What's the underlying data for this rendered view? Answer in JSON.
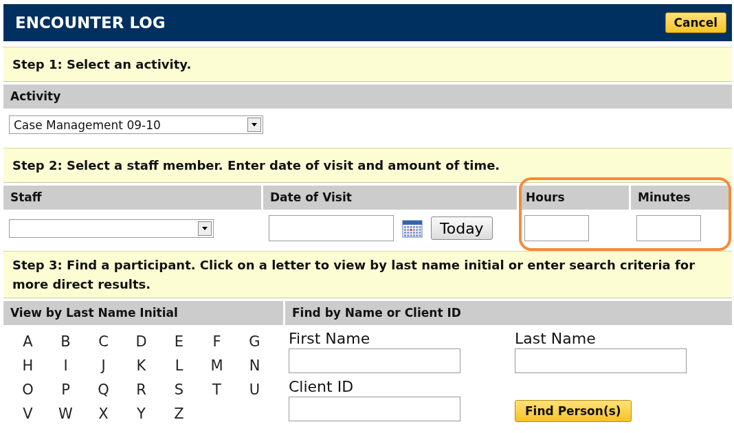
{
  "header": {
    "title": "ENCOUNTER LOG",
    "cancel_button": "Cancel"
  },
  "step1": {
    "instruction": "Step 1: Select an activity.",
    "column": "Activity",
    "activity_select": {
      "value": "Case Management 09-10"
    }
  },
  "step2": {
    "instruction": "Step 2: Select a staff member. Enter date of visit and amount of time.",
    "columns": [
      "Staff",
      "Date of Visit",
      "Hours",
      "Minutes"
    ],
    "today_button": "Today",
    "time_fields_circled": true
  },
  "step3": {
    "instruction": "Step 3: Find a participant. Click on a letter to view by last name initial or enter search criteria for more direct results.",
    "columns": [
      "View by Last Name Initial",
      "Find by Name or Client ID"
    ],
    "letters": [
      "A",
      "B",
      "C",
      "D",
      "E",
      "F",
      "G",
      "H",
      "I",
      "J",
      "K",
      "L",
      "M",
      "N",
      "O",
      "P",
      "Q",
      "R",
      "S",
      "T",
      "U",
      "V",
      "W",
      "X",
      "Y",
      "Z"
    ],
    "fields": [
      {
        "label": "First Name"
      },
      {
        "label": "Last Name"
      },
      {
        "label": "Client ID"
      }
    ],
    "find_button": "Find Person(s)"
  }
}
